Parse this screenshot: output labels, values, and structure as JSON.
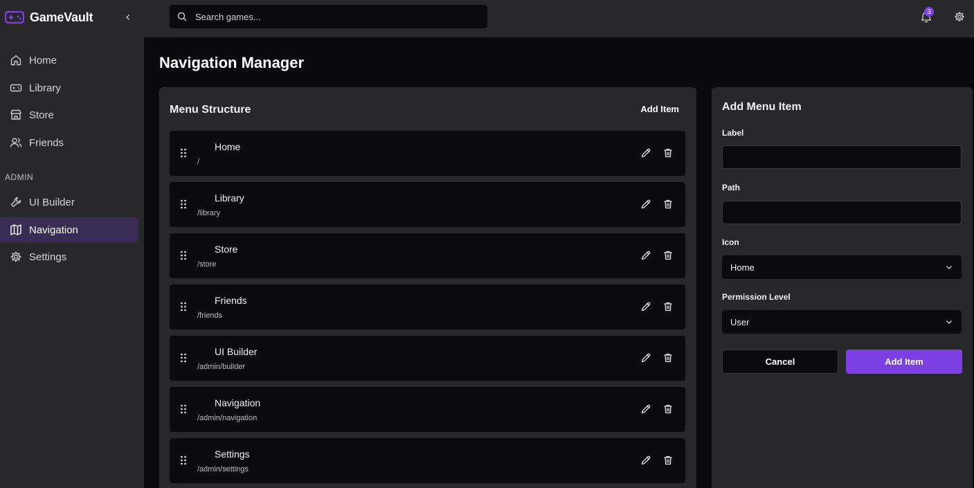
{
  "brand": {
    "title": "GameVault",
    "logo_icon": "gamepad-icon",
    "accent": "#7b3fe4"
  },
  "sidebar": {
    "collapse_icon": "chevron-left-icon",
    "items": [
      {
        "label": "Home",
        "icon": "home-icon"
      },
      {
        "label": "Library",
        "icon": "gamepad-icon"
      },
      {
        "label": "Store",
        "icon": "store-icon"
      },
      {
        "label": "Friends",
        "icon": "users-icon"
      }
    ],
    "admin_label": "ADMIN",
    "admin_items": [
      {
        "label": "UI Builder",
        "icon": "wrench-icon"
      },
      {
        "label": "Navigation",
        "icon": "map-icon",
        "active": true
      },
      {
        "label": "Settings",
        "icon": "gear-icon"
      }
    ],
    "active_color": "#3b2c55"
  },
  "topbar": {
    "search_placeholder": "Search games...",
    "notification_count": "3"
  },
  "page": {
    "title": "Navigation Manager"
  },
  "menu": {
    "title": "Menu Structure",
    "add_label": "Add Item",
    "rows": [
      {
        "label": "Home",
        "path": "/"
      },
      {
        "label": "Library",
        "path": "/library"
      },
      {
        "label": "Store",
        "path": "/store"
      },
      {
        "label": "Friends",
        "path": "/friends"
      },
      {
        "label": "UI Builder",
        "path": "/admin/builder"
      },
      {
        "label": "Navigation",
        "path": "/admin/navigation"
      },
      {
        "label": "Settings",
        "path": "/admin/settings"
      }
    ]
  },
  "form": {
    "title": "Add Menu Item",
    "label_label": "Label",
    "label_value": "",
    "path_label": "Path",
    "path_value": "",
    "icon_label": "Icon",
    "icon_value": "Home",
    "permission_label": "Permission Level",
    "permission_value": "User",
    "cancel_label": "Cancel",
    "submit_label": "Add Item"
  }
}
